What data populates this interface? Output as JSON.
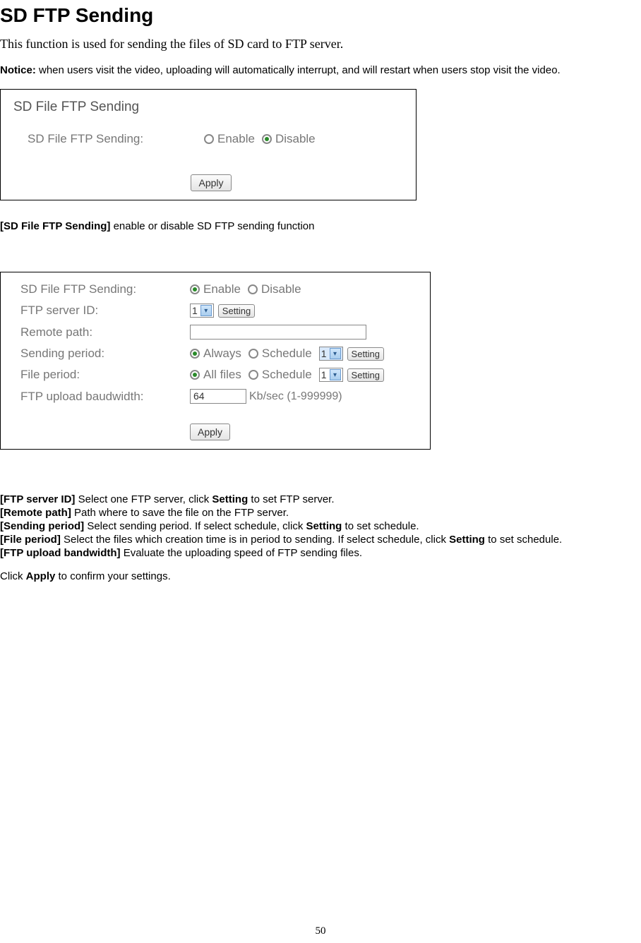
{
  "title": "SD FTP Sending",
  "intro": "This function is used for sending the files of SD card to FTP server.",
  "notice_label": "Notice:",
  "notice_text": " when users visit the video, uploading will automatically interrupt, and will restart when users stop visit the video.",
  "figure1": {
    "panel_title": "SD File FTP Sending",
    "row_label": "SD File FTP Sending:",
    "enable": "Enable",
    "disable": "Disable",
    "apply": "Apply"
  },
  "mid_line_label": "[SD File FTP Sending]",
  "mid_line_text": " enable or disable SD FTP sending function",
  "figure2": {
    "sd_label": "SD File FTP Sending:",
    "enable": "Enable",
    "disable": "Disable",
    "ftp_id_label": "FTP server ID:",
    "ftp_id_value": "1",
    "setting": "Setting",
    "remote_label": "Remote path:",
    "remote_value": "",
    "sending_label": "Sending period:",
    "always": "Always",
    "schedule": "Schedule",
    "sending_sched_value": "1",
    "file_label": "File period:",
    "all_files": "All files",
    "file_sched_value": "1",
    "bw_label": "FTP upload baudwidth:",
    "bw_value": "64",
    "bw_hint": "Kb/sec (1-999999)",
    "apply": "Apply"
  },
  "desc": {
    "ftp_id_label": "[FTP server ID]",
    "ftp_id_text_a": " Select one FTP server, click ",
    "ftp_id_bold": "Setting",
    "ftp_id_text_b": " to set FTP server.",
    "remote_label": "[Remote path]",
    "remote_text": " Path where to save the file on the FTP server.",
    "sending_label": "[Sending period]",
    "sending_text_a": " Select sending period. If select schedule, click ",
    "sending_bold": "Setting",
    "sending_text_b": " to set schedule.",
    "file_label": "[File period]",
    "file_text_a": " Select the files which creation time is in period to sending. If select schedule, click ",
    "file_bold": "Setting",
    "file_text_b": " to set schedule.",
    "bw_label": "[FTP upload bandwidth]",
    "bw_text": " Evaluate the uploading speed of FTP sending files.",
    "apply_text_a": "Click ",
    "apply_bold": "Apply",
    "apply_text_b": " to confirm your settings."
  },
  "page_number": "50"
}
